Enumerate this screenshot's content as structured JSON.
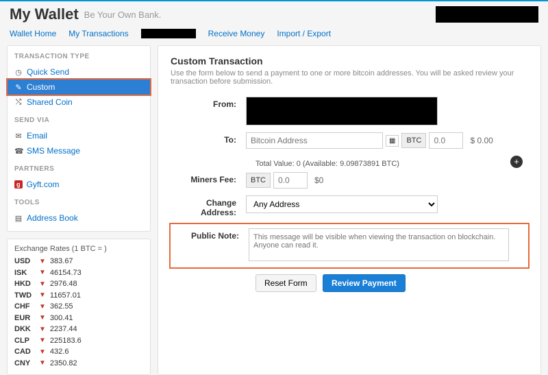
{
  "header": {
    "title": "My Wallet",
    "tagline": "Be Your Own Bank."
  },
  "nav": {
    "home": "Wallet Home",
    "tx": "My Transactions",
    "receive": "Receive Money",
    "import": "Import / Export"
  },
  "sidebar": {
    "txtype_title": "TRANSACTION TYPE",
    "quick": "Quick Send",
    "custom": "Custom",
    "shared": "Shared Coin",
    "sendvia_title": "SEND VIA",
    "email": "Email",
    "sms": "SMS Message",
    "partners_title": "PARTNERS",
    "gyft": "Gyft.com",
    "tools_title": "TOOLS",
    "addrbook": "Address Book"
  },
  "exrates": {
    "title": "Exchange Rates (1 BTC = )",
    "rows": [
      {
        "cur": "USD",
        "val": "383.67"
      },
      {
        "cur": "ISK",
        "val": "46154.73"
      },
      {
        "cur": "HKD",
        "val": "2976.48"
      },
      {
        "cur": "TWD",
        "val": "11657.01"
      },
      {
        "cur": "CHF",
        "val": "362.55"
      },
      {
        "cur": "EUR",
        "val": "300.41"
      },
      {
        "cur": "DKK",
        "val": "2237.44"
      },
      {
        "cur": "CLP",
        "val": "225183.6"
      },
      {
        "cur": "CAD",
        "val": "432.6"
      },
      {
        "cur": "CNY",
        "val": "2350.82"
      }
    ]
  },
  "form": {
    "heading": "Custom Transaction",
    "sub": "Use the form below to send a payment to one or more bitcoin addresses. You will be asked review your transaction before submission.",
    "from_lbl": "From:",
    "to_lbl": "To:",
    "to_placeholder": "Bitcoin Address",
    "btc_lbl": "BTC",
    "amt_placeholder": "0.0",
    "usd_val": "$ 0.00",
    "total": "Total Value: 0 (Available: 9.09873891 BTC)",
    "fee_lbl": "Miners Fee:",
    "fee_placeholder": "0.0",
    "fee_usd": "$0",
    "change_lbl": "Change Address:",
    "change_val": "Any Address",
    "note_lbl": "Public Note:",
    "note_placeholder": "This message will be visible when viewing the transaction on blockchain. Anyone can read it.",
    "reset": "Reset Form",
    "review": "Review Payment"
  }
}
